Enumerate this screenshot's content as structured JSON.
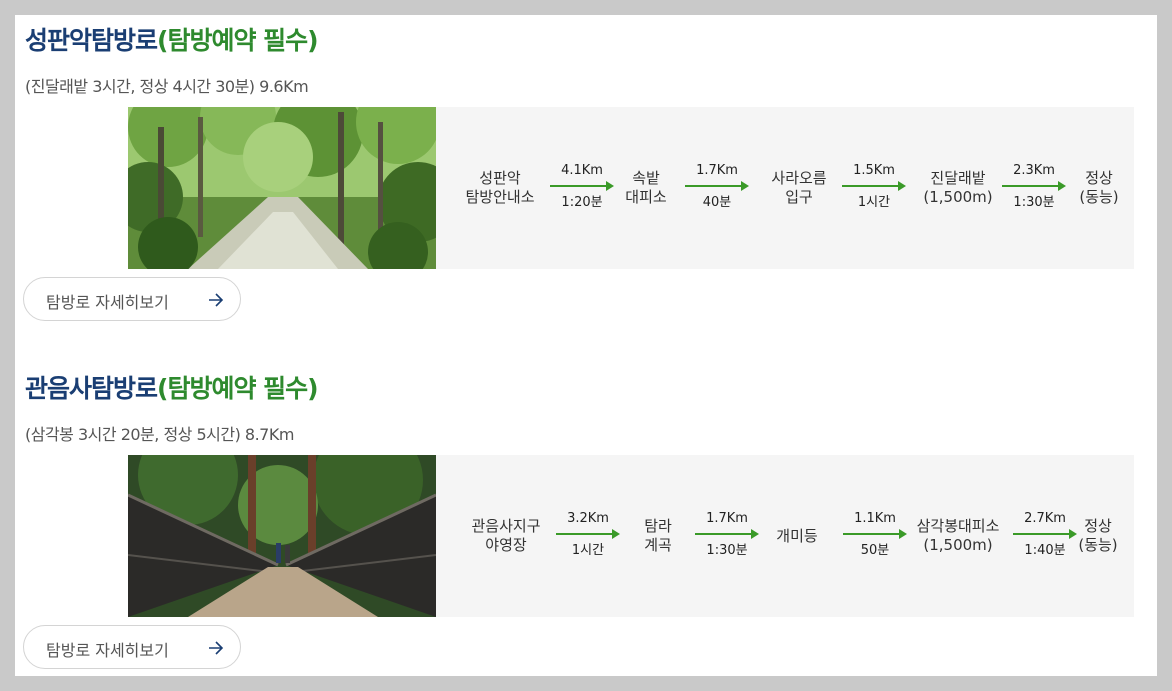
{
  "courses": [
    {
      "title": "성판악탐방로",
      "tag": "(탐방예약 필수)",
      "subtitle": "(진달래밭 3시간, 정상 4시간 30분) 9.6Km",
      "stops": [
        {
          "line1": "성판악",
          "line2": "탐방안내소"
        },
        {
          "line1": "속밭",
          "line2": "대피소"
        },
        {
          "line1": "사라오름",
          "line2": "입구"
        },
        {
          "line1": "진달래밭",
          "line2": "(1,500m)"
        },
        {
          "line1": "정상",
          "line2": "(동능)"
        }
      ],
      "legs": [
        {
          "distance": "4.1Km",
          "time": "1:20분"
        },
        {
          "distance": "1.7Km",
          "time": "40분"
        },
        {
          "distance": "1.5Km",
          "time": "1시간"
        },
        {
          "distance": "2.3Km",
          "time": "1:30분"
        }
      ],
      "button_label": "탐방로 자세히보기"
    },
    {
      "title": "관음사탐방로",
      "tag": "(탐방예약 필수)",
      "subtitle": "(삼각봉 3시간 20분, 정상 5시간) 8.7Km",
      "stops": [
        {
          "line1": "관음사지구",
          "line2": "야영장"
        },
        {
          "line1": "탐라",
          "line2": "계곡"
        },
        {
          "line1": "개미등",
          "line2": ""
        },
        {
          "line1": "삼각봉대피소",
          "line2": "(1,500m)"
        },
        {
          "line1": "정상",
          "line2": "(동능)"
        }
      ],
      "legs": [
        {
          "distance": "3.2Km",
          "time": "1시간"
        },
        {
          "distance": "1.7Km",
          "time": "1:30분"
        },
        {
          "distance": "1.1Km",
          "time": "50분"
        },
        {
          "distance": "2.7Km",
          "time": "1:40분"
        }
      ],
      "button_label": "탐방로 자세히보기"
    }
  ],
  "colors": {
    "title": "#1a3e73",
    "tag": "#2e8a2e",
    "arrow": "#3a9a28"
  },
  "icons": {
    "button_arrow": "arrow-right-icon",
    "photo_1": "forest-trail-photo",
    "photo_2": "suspension-bridge-photo"
  }
}
